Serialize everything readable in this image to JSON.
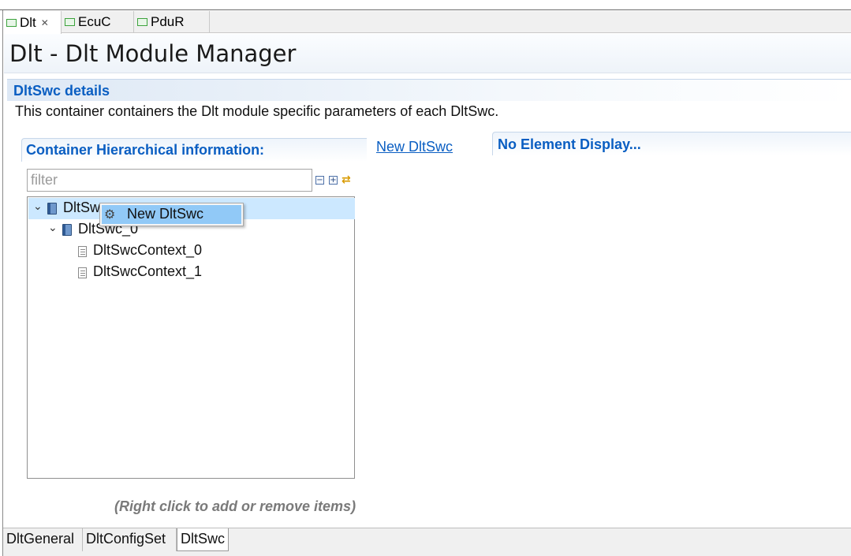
{
  "editor_tabs": [
    {
      "label": "Dlt",
      "active": true,
      "closable": true
    },
    {
      "label": "EcuC",
      "active": false,
      "closable": false
    },
    {
      "label": "PduR",
      "active": false,
      "closable": false
    }
  ],
  "page_title": "Dlt - Dlt Module Manager",
  "section": {
    "title": "DltSwc details",
    "description": "This container containers the Dlt module specific parameters of each DltSwc."
  },
  "container_panel": {
    "title": "Container Hierarchical information:",
    "filter_placeholder": "filter",
    "hint": "(Right click to add or remove items)"
  },
  "new_link": "New DltSwc",
  "element_display": {
    "title": "No Element Display..."
  },
  "tree": [
    {
      "label": "DltSw",
      "level": 0,
      "expanded": true,
      "type": "container",
      "selected": true
    },
    {
      "label": "DltSwc_0",
      "level": 1,
      "expanded": true,
      "type": "container",
      "selected": false
    },
    {
      "label": "DltSwcContext_0",
      "level": 2,
      "type": "leaf",
      "selected": false
    },
    {
      "label": "DltSwcContext_1",
      "level": 2,
      "type": "leaf",
      "selected": false
    }
  ],
  "context_menu": {
    "items": [
      {
        "label": "New DltSwc",
        "icon": "gears-icon",
        "highlighted": true
      }
    ]
  },
  "bottom_tabs": [
    {
      "label": "DltGeneral",
      "active": false
    },
    {
      "label": "DltConfigSet",
      "active": false
    },
    {
      "label": "DltSwc",
      "active": true
    }
  ],
  "colors": {
    "accent": "#0a5ec2",
    "selection": "#cce8ff",
    "menu_highlight": "#91c9f7"
  }
}
